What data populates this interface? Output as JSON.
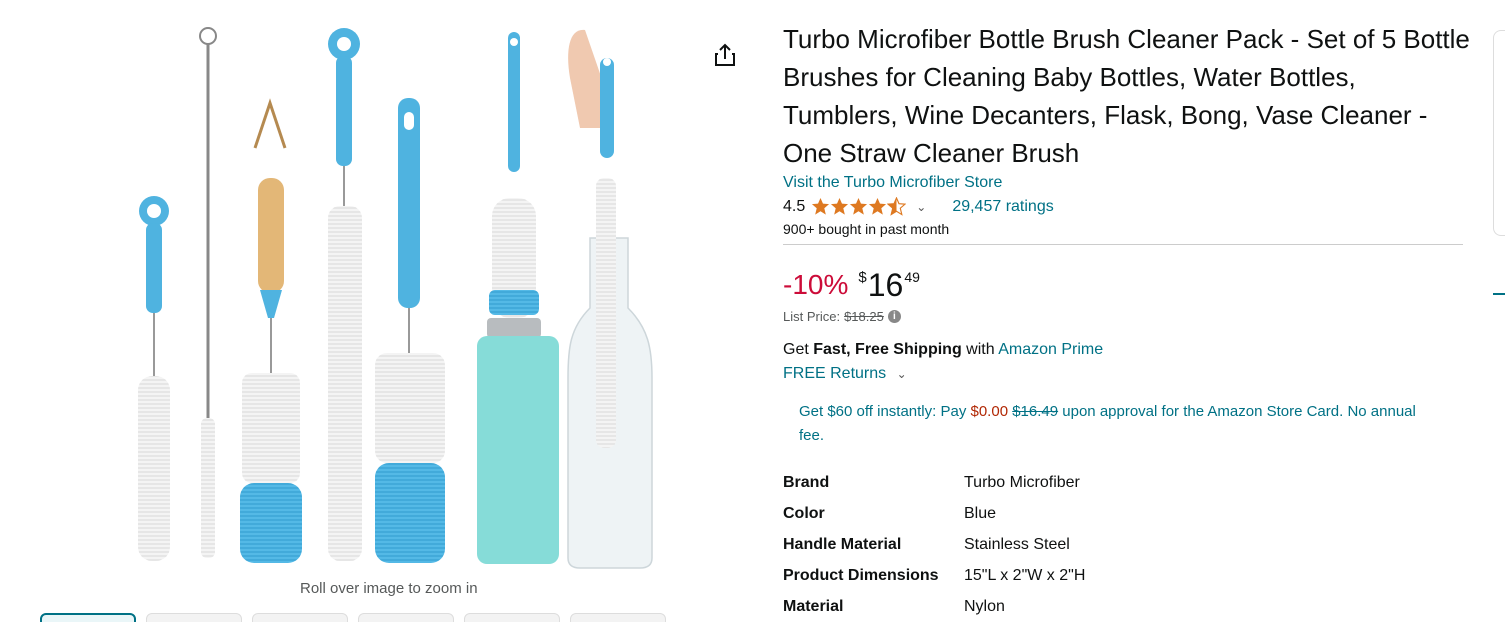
{
  "product": {
    "title": "Turbo Microfiber Bottle Brush Cleaner Pack - Set of 5 Bottle Brushes for Cleaning Baby Bottles, Water Bottles, Tumblers, Wine Decanters, Flask, Bong, Vase Cleaner - One Straw Cleaner Brush",
    "store_link": "Visit the Turbo Microfiber Store",
    "rating": "4.5",
    "rating_value": 4.5,
    "ratings_count": "29,457 ratings",
    "bought": "900+ bought in past month"
  },
  "price": {
    "discount": "-10%",
    "currency": "$",
    "whole": "16",
    "fraction": "49",
    "list_label": "List Price:",
    "list_value": "$18.25"
  },
  "shipping": {
    "get": "Get",
    "fast_free": "Fast, Free Shipping",
    "with": "with",
    "prime": "Amazon Prime",
    "returns": "FREE Returns"
  },
  "card_offer": {
    "part1": "Get $60 off instantly: Pay",
    "pay": "$0.00",
    "old": "$16.49",
    "part2": "upon approval for the Amazon Store Card. No annual fee."
  },
  "specs": [
    {
      "key": "Brand",
      "value": "Turbo Microfiber"
    },
    {
      "key": "Color",
      "value": "Blue"
    },
    {
      "key": "Handle Material",
      "value": "Stainless Steel"
    },
    {
      "key": "Product Dimensions",
      "value": "15\"L x 2\"W x 2\"H"
    },
    {
      "key": "Material",
      "value": "Nylon"
    }
  ],
  "image": {
    "zoom_hint": "Roll over image to zoom in"
  },
  "colors": {
    "link": "#007185",
    "discount": "#cc0c39",
    "star": "#de7921",
    "brush_blue": "#4fb3e0"
  },
  "icons": {
    "share": "share-icon",
    "star": "star-icon",
    "chevron": "chevron-down-icon",
    "info": "info-icon"
  }
}
